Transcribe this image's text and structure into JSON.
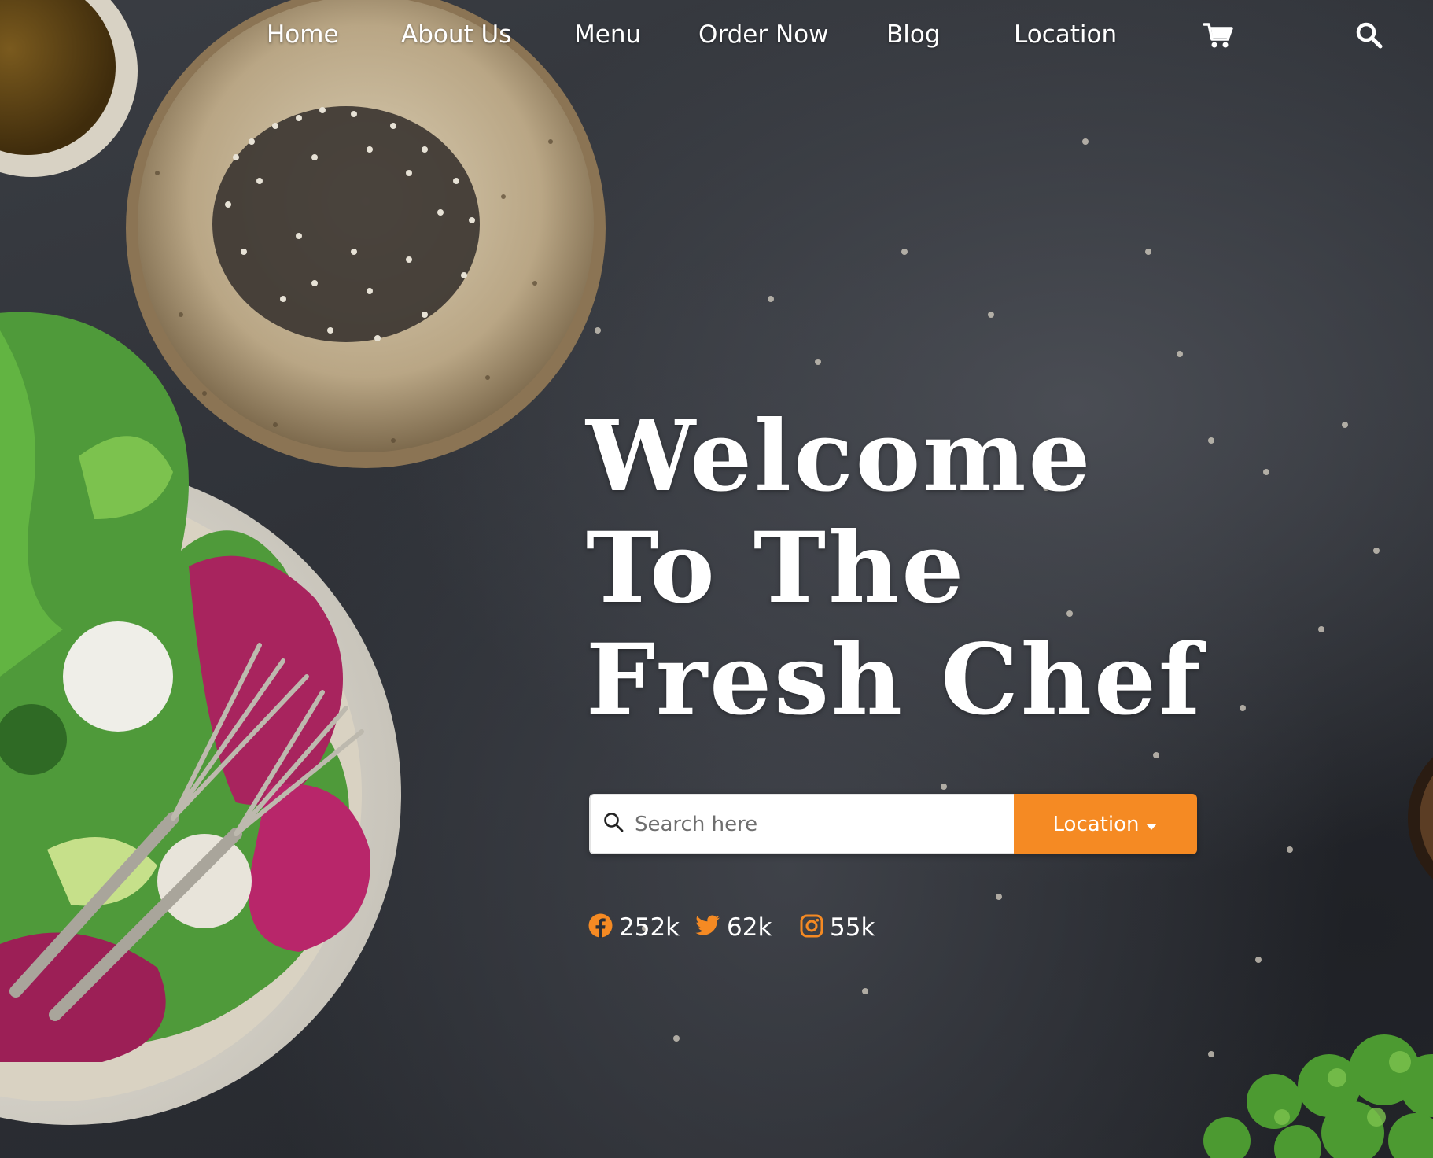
{
  "nav": {
    "items": [
      {
        "label": "Home"
      },
      {
        "label": "About Us"
      },
      {
        "label": "Menu"
      },
      {
        "label": "Order Now"
      },
      {
        "label": "Blog"
      },
      {
        "label": "Location"
      }
    ],
    "cart_icon": "cart-icon",
    "search_icon": "search-icon"
  },
  "hero": {
    "title_lines": [
      "Welcome",
      "To The",
      "Fresh Chef"
    ]
  },
  "search": {
    "placeholder": "Search here",
    "value": "",
    "location_label": "Location"
  },
  "social": [
    {
      "icon": "facebook-icon",
      "count": "252k"
    },
    {
      "icon": "twitter-icon",
      "count": "62k"
    },
    {
      "icon": "instagram-icon",
      "count": "55k"
    }
  ],
  "colors": {
    "accent": "#f58a23",
    "background": "#2c2f35",
    "text": "#ffffff"
  }
}
